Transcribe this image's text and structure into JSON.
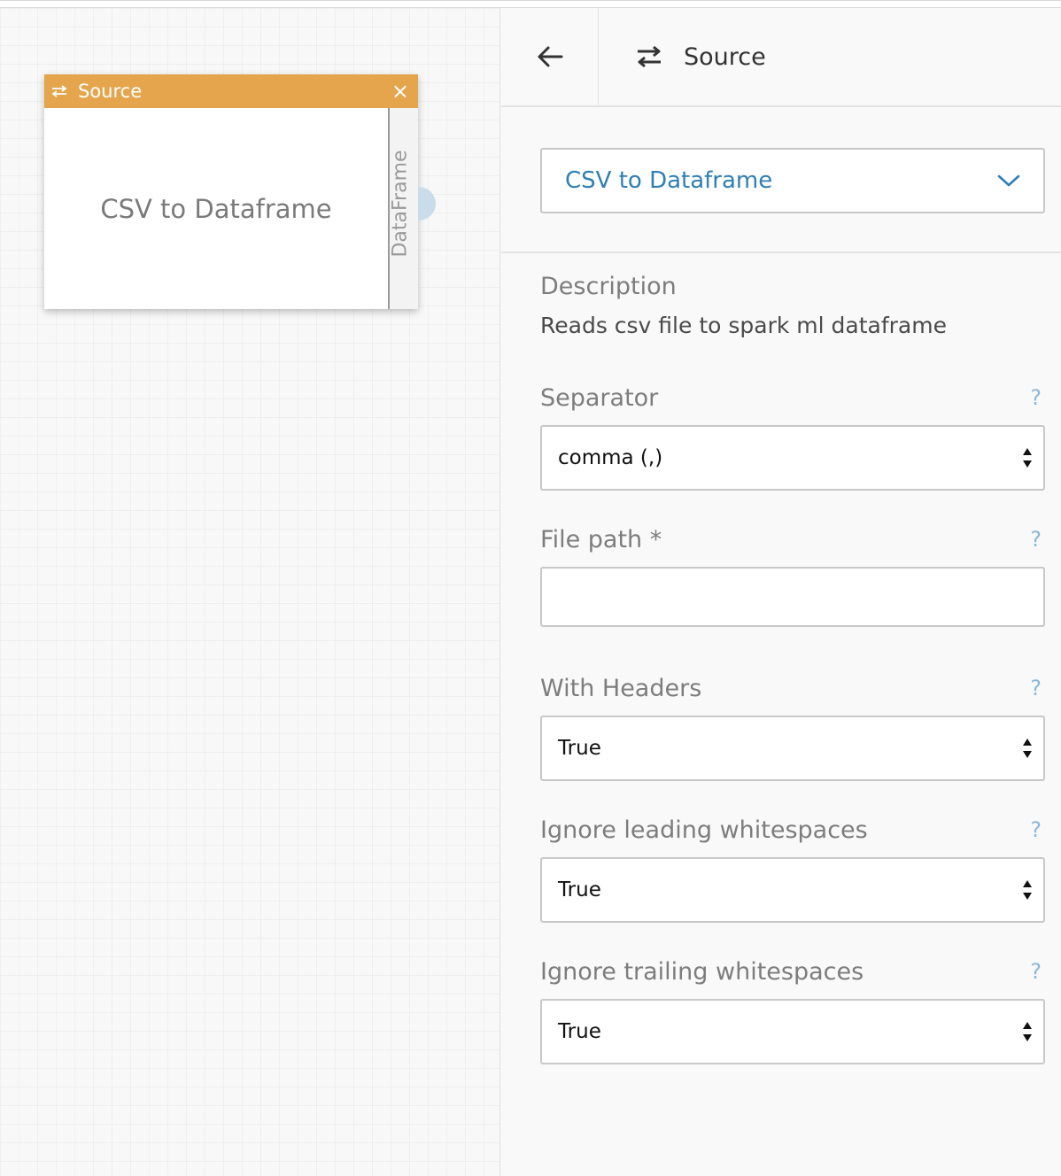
{
  "canvas": {
    "node": {
      "header_title": "Source",
      "close_glyph": "×",
      "header_icon": "swap-arrows-icon",
      "body_label": "CSV to Dataframe",
      "output_port_label": "DataFrame",
      "header_color": "#e5a54d"
    }
  },
  "panel": {
    "header": {
      "back_icon": "arrow-left-icon",
      "icon": "swap-arrows-icon",
      "title": "Source"
    },
    "operation": {
      "selected": "CSV to Dataframe",
      "accent_color": "#2f7fb5"
    },
    "description": {
      "title": "Description",
      "text": "Reads csv file to spark ml dataframe"
    },
    "fields": {
      "separator": {
        "label": "Separator",
        "value": "comma (,)",
        "help": "?"
      },
      "file_path": {
        "label": "File path *",
        "value": "",
        "help": "?"
      },
      "with_headers": {
        "label": "With Headers",
        "value": "True",
        "help": "?"
      },
      "ignore_leading": {
        "label": "Ignore leading whitespaces",
        "value": "True",
        "help": "?"
      },
      "ignore_trailing": {
        "label": "Ignore trailing whitespaces",
        "value": "True",
        "help": "?"
      }
    }
  }
}
